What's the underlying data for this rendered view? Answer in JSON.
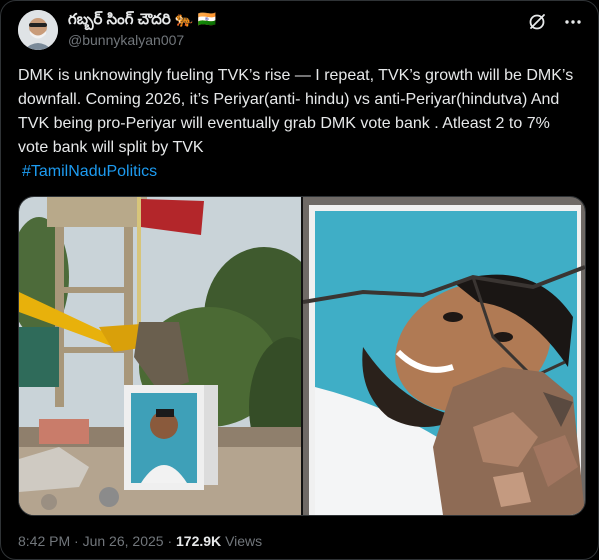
{
  "author": {
    "display_name": "గబ్బర్ సింగ్ చౌదరి 🐅 🇮🇳",
    "handle": "@bunnykalyan007",
    "avatar_icon": "avatar-photo"
  },
  "tweet": {
    "text": "DMK is unknowingly fueling TVK’s rise — I repeat, TVK’s growth will be DMK’s downfall. Coming 2026, it’s Periyar(anti- hindu)  vs anti-Periyar(hindutva) And TVK being pro-Periyar will eventually grab DMK vote bank . Atleast 2 to 7% vote bank will split by TVK",
    "hashtag": "#TamilNaduPolitics"
  },
  "media": {
    "image_count": 2,
    "left_photo": "excavator-demolishing-wall-portrait",
    "right_photo": "broken-portrait-closeup"
  },
  "meta": {
    "time": "8:42 PM",
    "separator": "·",
    "date": "Jun 26, 2025",
    "views_count": "172.9K",
    "views_label": "Views"
  },
  "icons": [
    "grok-icon",
    "more-icon"
  ],
  "colors": {
    "background": "#000000",
    "text": "#e7e9ea",
    "muted": "#71767b",
    "link": "#1d9bf0",
    "border": "#2f3336"
  }
}
